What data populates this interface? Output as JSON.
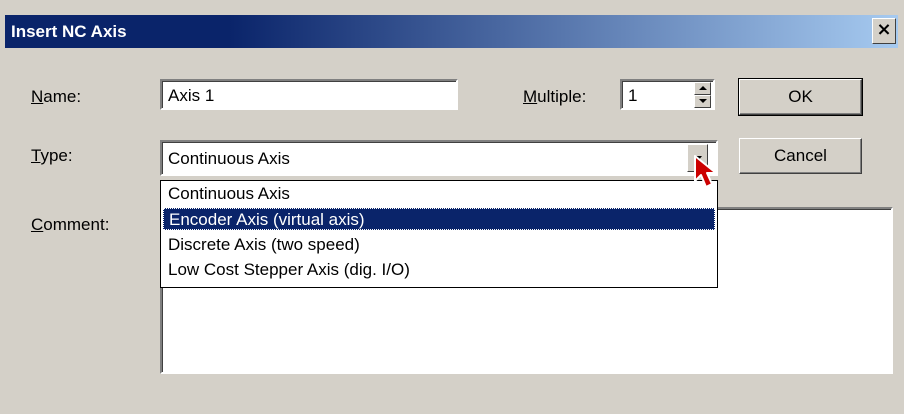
{
  "window": {
    "title": "Insert NC Axis",
    "close_label": "×"
  },
  "name_field": {
    "label_underline": "N",
    "label_rest": "ame:",
    "value": "Axis 1"
  },
  "multiple_field": {
    "label_underline": "M",
    "label_rest": "ultiple:",
    "value": "1"
  },
  "type_field": {
    "label_underline": "T",
    "label_rest": "ype:",
    "selected": "Continuous Axis",
    "options": [
      "Continuous Axis",
      "Encoder Axis (virtual axis)",
      "Discrete Axis (two speed)",
      "Low Cost Stepper Axis (dig. I/O)"
    ],
    "highlighted_option": "Encoder Axis (virtual axis)"
  },
  "comment_field": {
    "label_underline": "C",
    "label_rest": "omment:",
    "value": ""
  },
  "buttons": {
    "ok": "OK",
    "cancel": "Cancel"
  },
  "colors": {
    "title_bar_start": "#0a246a",
    "title_bar_end": "#a6caf0",
    "selection": "#0a246a",
    "dialog_bg": "#d4d0c8",
    "cursor": "#cc0000"
  }
}
